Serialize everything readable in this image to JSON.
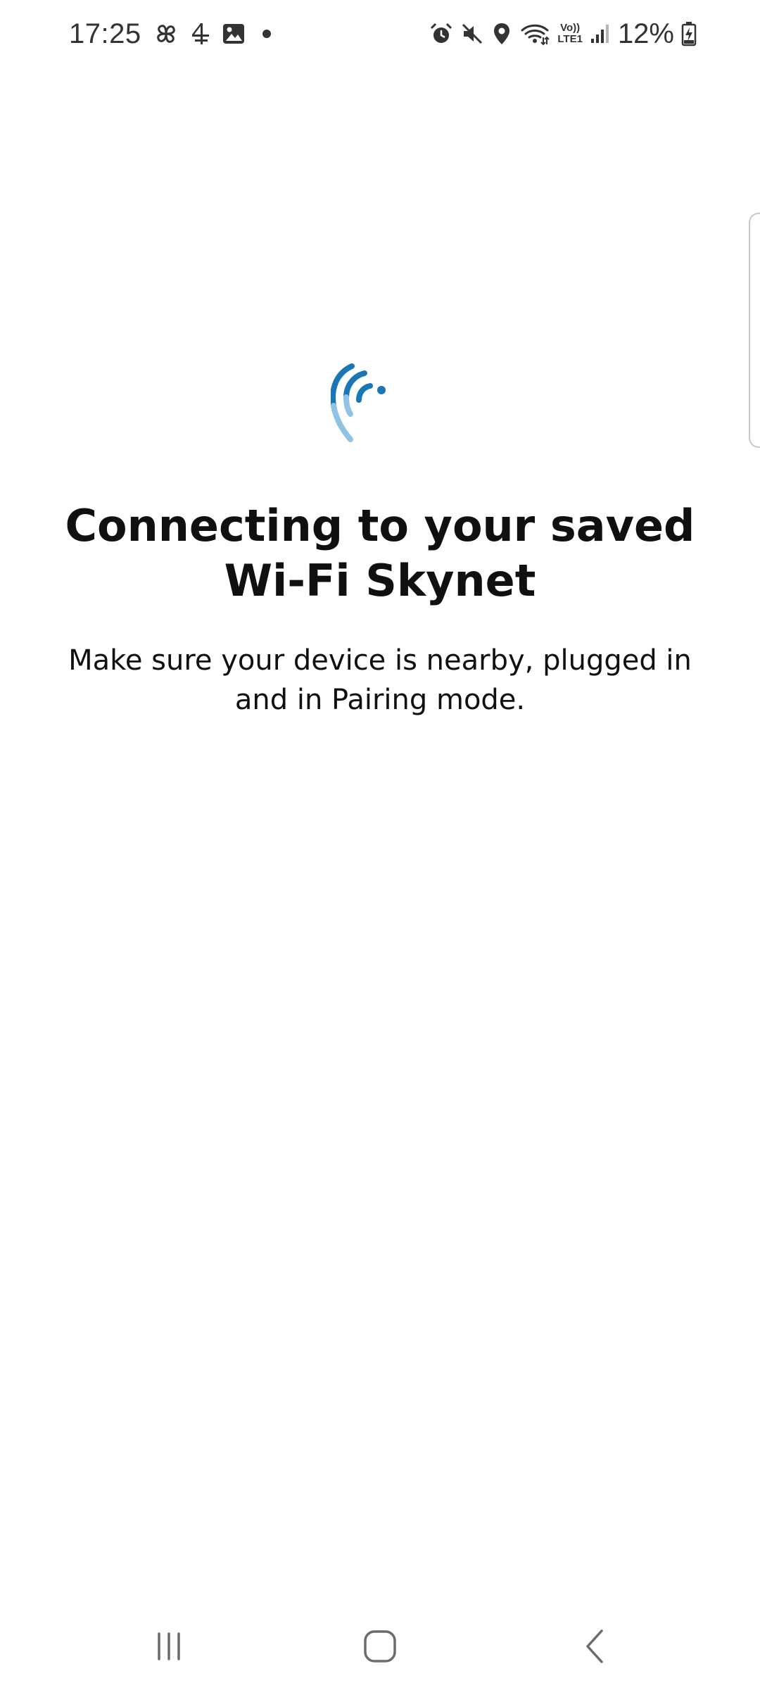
{
  "status_bar": {
    "time": "17:25",
    "lte_line1": "Vo))",
    "lte_line2": "LTE1",
    "battery_percent": "12%",
    "left_icons": [
      "pinwheel-icon",
      "channel4-icon",
      "gallery-icon",
      "notification-dot-icon"
    ],
    "right_icons": [
      "alarm-icon",
      "mute-icon",
      "location-icon",
      "wifi-icon",
      "volte-lte-icon",
      "signal-icon",
      "battery-charging-icon"
    ]
  },
  "main": {
    "graphic_icon": "connecting-signal-icon",
    "title": "Connecting to your saved Wi-Fi Skynet",
    "subtitle": "Make sure your device is nearby, plugged in and in Pairing mode."
  },
  "nav_bar": {
    "recents_icon": "recents-icon",
    "home_icon": "home-icon",
    "back_icon": "back-icon"
  },
  "colors": {
    "accent_dark": "#1a76b4",
    "accent_light": "#8fc3e3",
    "text_primary": "#0f1111",
    "status_text": "#333333",
    "nav_icon": "#6b6b6b"
  }
}
